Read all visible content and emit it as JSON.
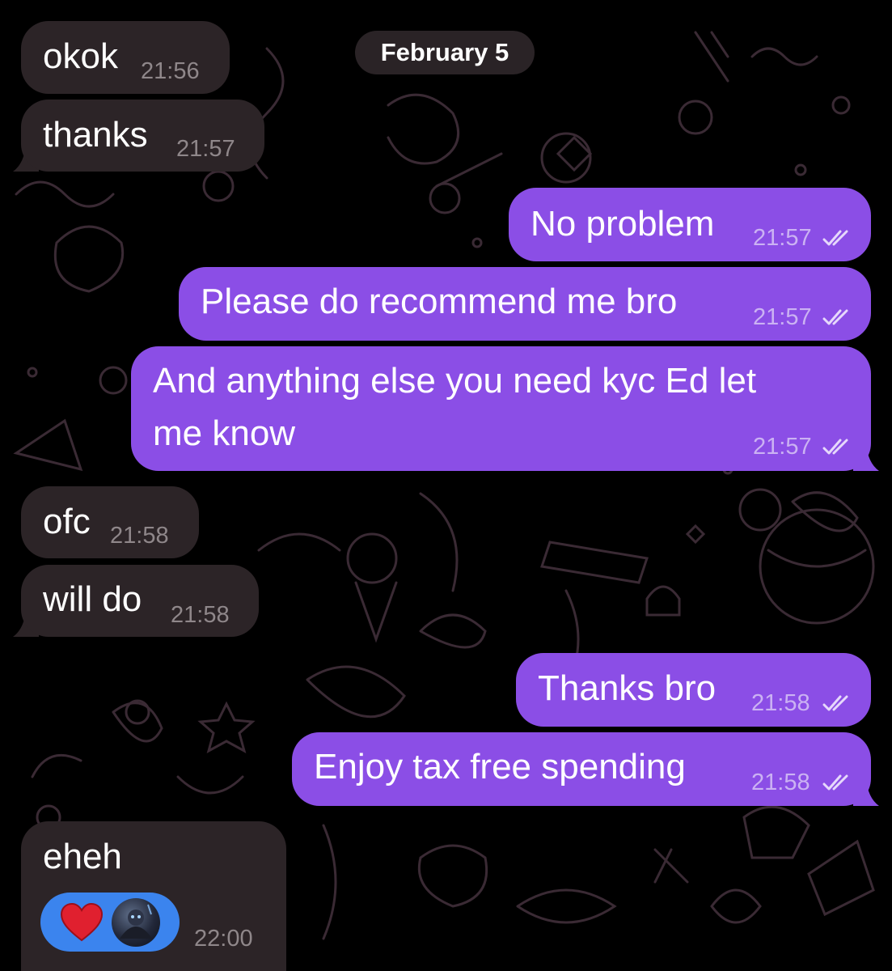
{
  "date_separator": "February 5",
  "messages": [
    {
      "direction": "incoming",
      "text": "okok",
      "time": "21:56"
    },
    {
      "direction": "incoming",
      "text": "thanks",
      "time": "21:57"
    },
    {
      "direction": "outgoing",
      "text": "No problem",
      "time": "21:57",
      "status": "read"
    },
    {
      "direction": "outgoing",
      "text": "Please do recommend me bro",
      "time": "21:57",
      "status": "read"
    },
    {
      "direction": "outgoing",
      "text_line1": "And anything else you need kyc Ed let",
      "text_line2": "me know",
      "time": "21:57",
      "status": "read"
    },
    {
      "direction": "incoming",
      "text": "ofc",
      "time": "21:58"
    },
    {
      "direction": "incoming",
      "text": "will do",
      "time": "21:58"
    },
    {
      "direction": "outgoing",
      "text": "Thanks bro",
      "time": "21:58",
      "status": "read"
    },
    {
      "direction": "outgoing",
      "text": "Enjoy tax free spending",
      "time": "21:58",
      "status": "read"
    },
    {
      "direction": "incoming",
      "text": "eheh",
      "time": "22:00",
      "reaction": {
        "emoji": "red-heart",
        "reactor": "avatar"
      }
    }
  ],
  "colors": {
    "background": "#000000",
    "incoming_bubble": "#2c2427",
    "outgoing_bubble": "#8b4ee6",
    "reaction_pill": "#3b84ee",
    "heart": "#e0202f"
  }
}
